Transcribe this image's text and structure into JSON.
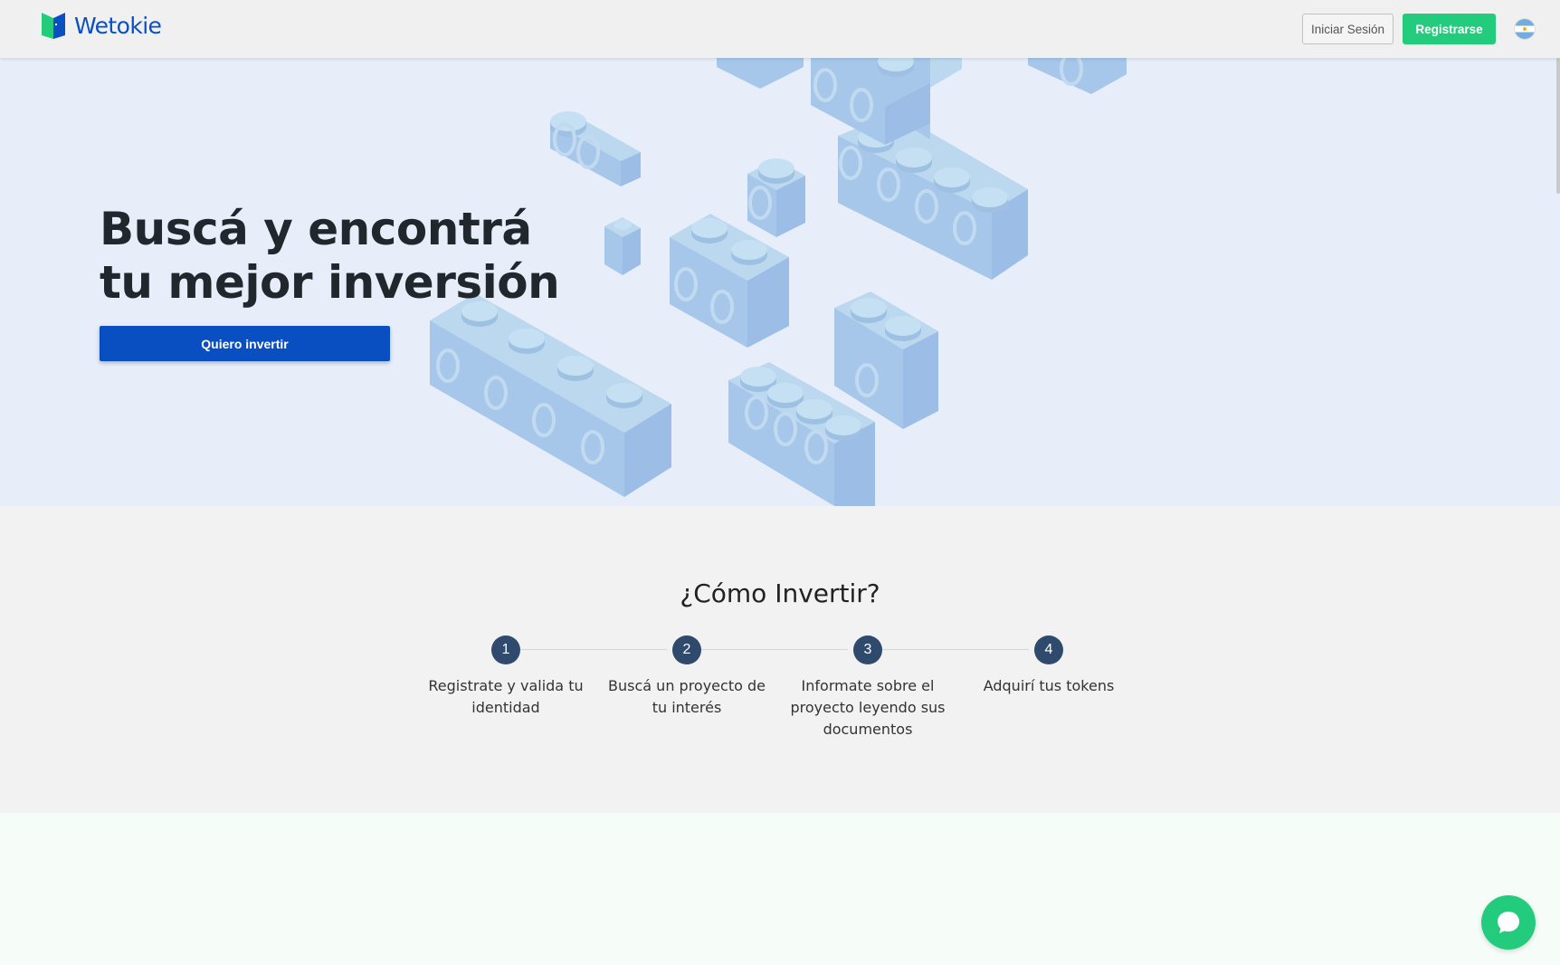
{
  "header": {
    "brand": "Wetokie",
    "login_label": "Iniciar Sesión",
    "register_label": "Registrarse",
    "language_flag": "flag-argentina-icon"
  },
  "hero": {
    "title_line1": "Buscá y encontrá",
    "title_line2": "tu mejor inversión",
    "cta_label": "Quiero invertir"
  },
  "how": {
    "title": "¿Cómo Invertir?",
    "steps": [
      {
        "number": "1",
        "text": "Registrate y valida tu identidad"
      },
      {
        "number": "2",
        "text": "Buscá un proyecto de tu interés"
      },
      {
        "number": "3",
        "text": "Informate sobre el proyecto leyendo sus documentos"
      },
      {
        "number": "4",
        "text": "Adquirí tus tokens"
      }
    ]
  },
  "colors": {
    "brand_blue": "#0a4fc2",
    "brand_green": "#23cc7d",
    "step_circle": "#2f4a6d",
    "hero_bg": "#e7eef9"
  },
  "icons": {
    "chat": "chat-bubble-icon",
    "logo": "wetokie-logo-icon"
  }
}
